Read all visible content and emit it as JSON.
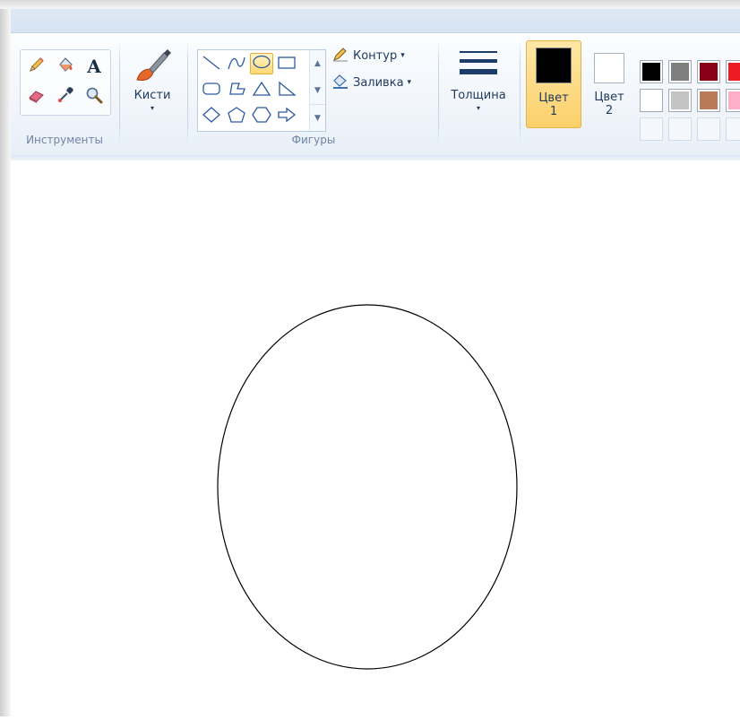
{
  "ribbon": {
    "tools": {
      "group_label": "Инструменты",
      "items": [
        {
          "name": "pencil",
          "icon": "pencil-icon"
        },
        {
          "name": "fill",
          "icon": "fill-bucket-icon"
        },
        {
          "name": "text",
          "icon": "text-icon",
          "glyph": "A"
        },
        {
          "name": "eraser",
          "icon": "eraser-icon"
        },
        {
          "name": "color-picker",
          "icon": "color-picker-icon"
        },
        {
          "name": "magnifier",
          "icon": "magnifier-icon"
        }
      ]
    },
    "brushes": {
      "label": "Кисти",
      "caret": "▾",
      "icon": "brush-icon"
    },
    "shapes": {
      "group_label": "Фигуры",
      "items": [
        "line",
        "curve",
        "oval",
        "rectangle",
        "rounded-rectangle",
        "polygon",
        "triangle",
        "right-triangle",
        "diamond",
        "pentagon",
        "hexagon",
        "right-arrow"
      ],
      "selected": "oval",
      "scroll_up": "▲",
      "scroll_down": "▼",
      "scroll_more": "▼",
      "outline_label": "Контур",
      "fill_label": "Заливка",
      "caret": "▾"
    },
    "size": {
      "label": "Толщина",
      "caret": "▾",
      "icon": "line-thickness-icon"
    },
    "colors": {
      "color1_label_line1": "Цвет",
      "color1_label_line2": "1",
      "color1_value": "#000000",
      "color2_label_line1": "Цвет",
      "color2_label_line2": "2",
      "color2_value": "#ffffff",
      "palette_row1": [
        "#000000",
        "#7f7f7f",
        "#880015",
        "#ed1c24"
      ],
      "palette_row2": [
        "#ffffff",
        "#c3c3c3",
        "#b97a57",
        "#ffaec9"
      ]
    },
    "accent_selected": "#fbd06a"
  },
  "canvas": {
    "shape": "ellipse",
    "stroke_color": "#000000",
    "background": "#ffffff"
  }
}
